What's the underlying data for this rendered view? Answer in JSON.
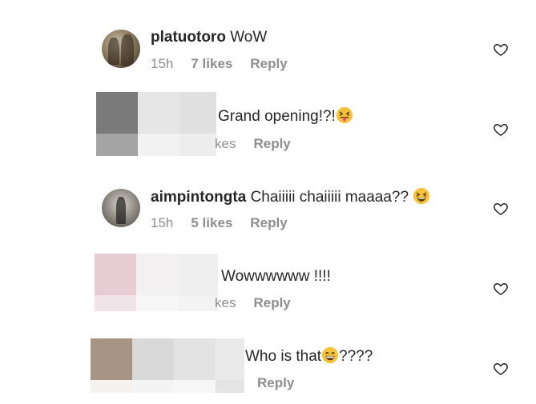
{
  "comments": [
    {
      "username": "platuotoro",
      "text": "WoW",
      "time": "15h",
      "likes": "7 likes",
      "reply": "Reply",
      "avatar": "profile-photo"
    },
    {
      "username": "",
      "text": "Grand opening!?!",
      "emoji": "squinting-tongue-face",
      "likes_partial": "kes",
      "reply": "Reply",
      "avatar": "pixelated-redacted"
    },
    {
      "username": "aimpintongta",
      "text": "Chaiiiii chaiiiii maaaa??",
      "emoji": "grinning-squinting-face",
      "time": "15h",
      "likes": "5 likes",
      "reply": "Reply",
      "avatar": "profile-photo"
    },
    {
      "username": "",
      "text": "Wowwwwww !!!!",
      "likes_partial": "kes",
      "reply": "Reply",
      "avatar": "pixelated-redacted"
    },
    {
      "username": "",
      "text": "Who is that",
      "emoji": "beaming-face",
      "text_suffix": "????",
      "reply": "Reply",
      "avatar": "pixelated-redacted"
    }
  ],
  "icons": {
    "like": "heart-outline-icon"
  },
  "colors": {
    "text": "#262626",
    "meta": "#8e8e8e",
    "background": "#ffffff",
    "emoji": "#f7c23b"
  }
}
